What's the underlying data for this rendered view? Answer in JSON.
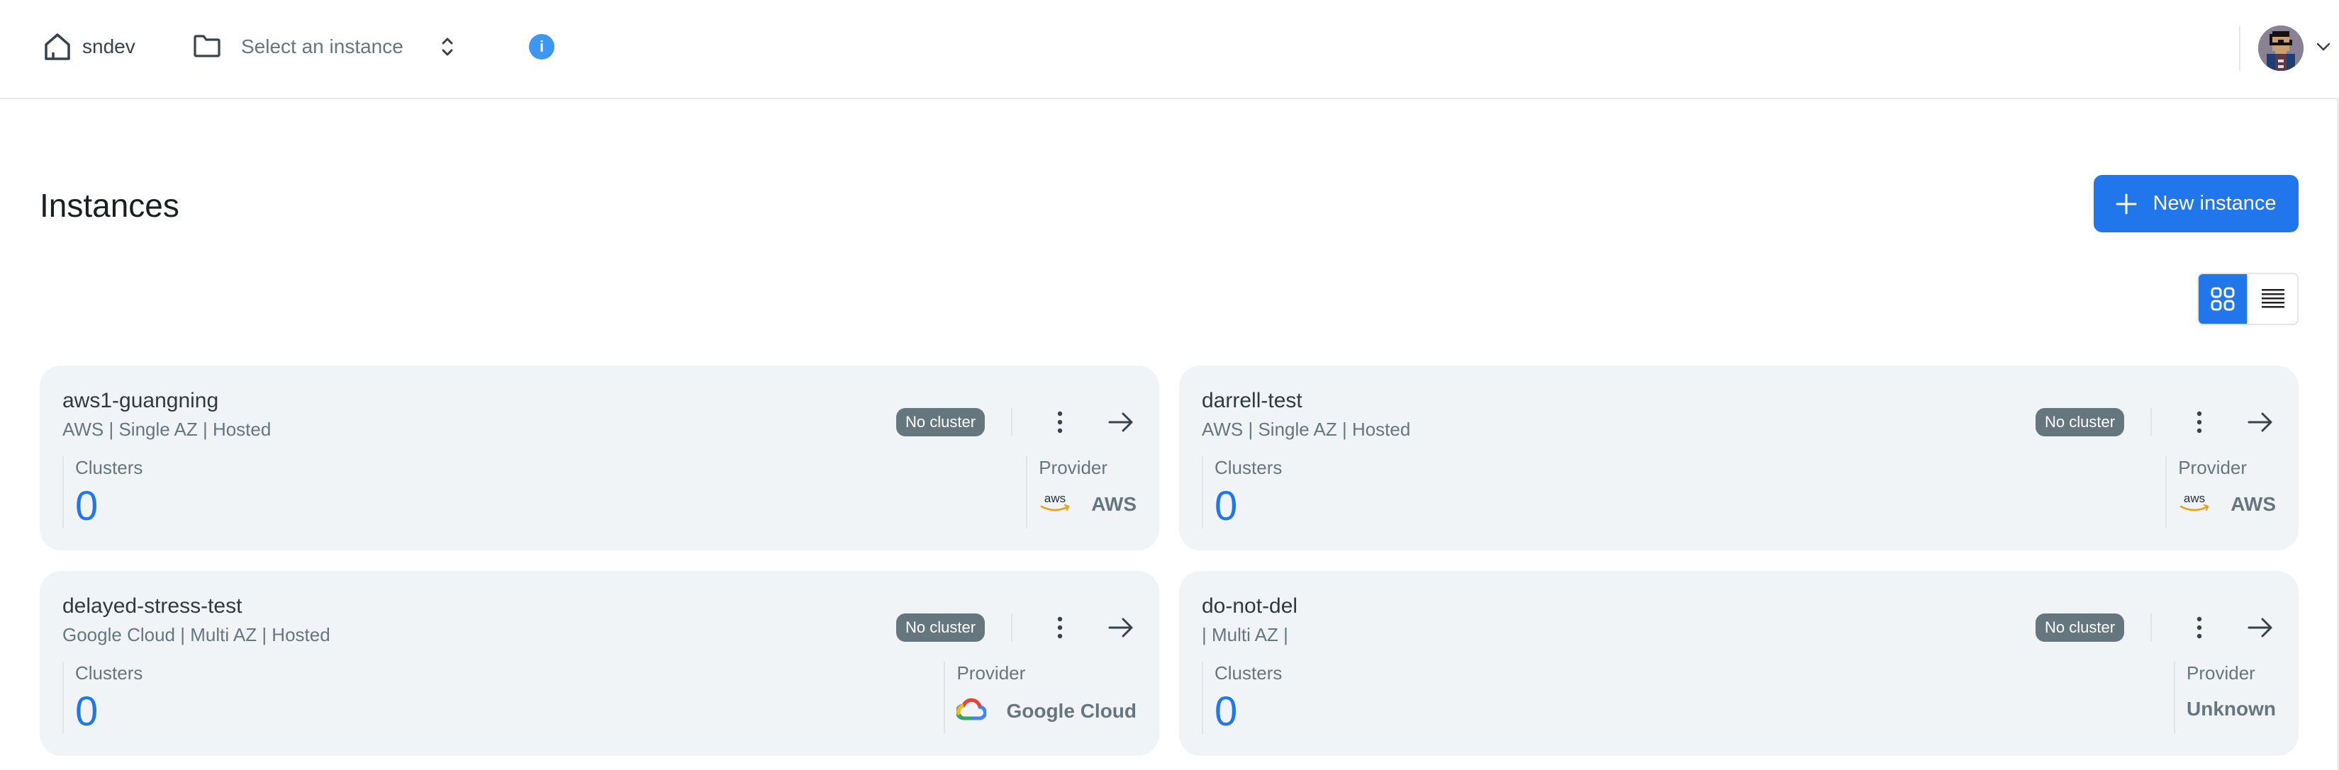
{
  "header": {
    "org_name": "sndev",
    "instance_selector_placeholder": "Select an instance",
    "info_glyph": "i",
    "icons": {
      "home": "home-icon",
      "folder": "folder-icon",
      "selector": "chevron-up-down-icon",
      "info": "info-icon",
      "account_menu": "chevron-down-icon"
    }
  },
  "page": {
    "title": "Instances",
    "new_button_label": "New instance",
    "view_toggle": {
      "active": "grid",
      "options": [
        "grid",
        "list"
      ]
    }
  },
  "colors": {
    "accent": "#2176ec",
    "info": "#3d97ef",
    "badge_bg": "#66767f",
    "card_bg": "#f1f4f6",
    "aws_orange": "#f39c12"
  },
  "instances": [
    {
      "name": "aws1-guangning",
      "subtitle": "AWS | Single AZ | Hosted",
      "status_badge": "No cluster",
      "clusters_label": "Clusters",
      "clusters_value": "0",
      "provider_label": "Provider",
      "provider_name": "AWS",
      "provider_icon": "aws-logo-icon"
    },
    {
      "name": "darrell-test",
      "subtitle": "AWS | Single AZ | Hosted",
      "status_badge": "No cluster",
      "clusters_label": "Clusters",
      "clusters_value": "0",
      "provider_label": "Provider",
      "provider_name": "AWS",
      "provider_icon": "aws-logo-icon"
    },
    {
      "name": "delayed-stress-test",
      "subtitle": "Google Cloud | Multi AZ | Hosted",
      "status_badge": "No cluster",
      "clusters_label": "Clusters",
      "clusters_value": "0",
      "provider_label": "Provider",
      "provider_name": "Google Cloud",
      "provider_icon": "google-cloud-logo-icon"
    },
    {
      "name": "do-not-del",
      "subtitle": "| Multi AZ |",
      "status_badge": "No cluster",
      "clusters_label": "Clusters",
      "clusters_value": "0",
      "provider_label": "Provider",
      "provider_name": "Unknown",
      "provider_icon": ""
    }
  ]
}
